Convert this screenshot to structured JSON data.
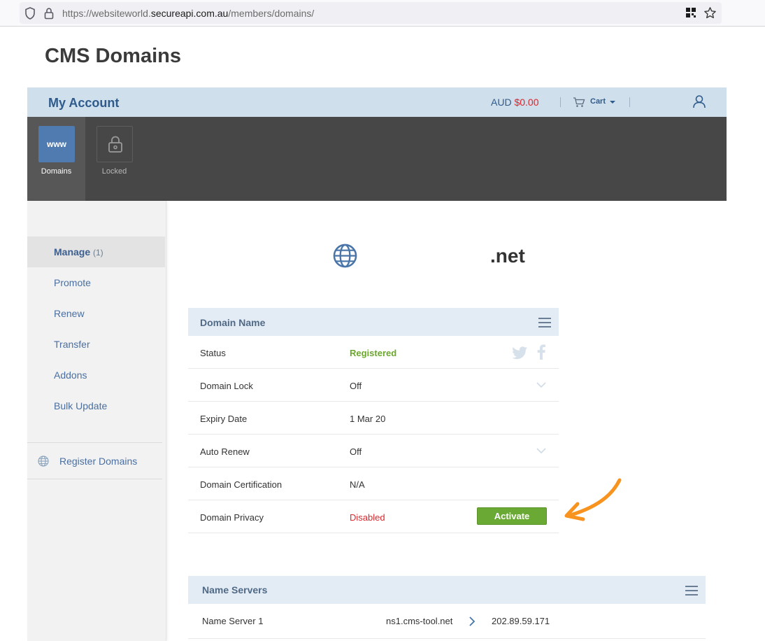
{
  "browser": {
    "url_prefix": "https://websiteworld.",
    "url_domain": "secureapi.com.au",
    "url_path": "/members/domains/"
  },
  "page": {
    "title": "CMS Domains"
  },
  "account_bar": {
    "title": "My Account",
    "currency": "AUD",
    "balance": "$0.00",
    "cart_label": "Cart"
  },
  "tools": [
    {
      "tile_text": "www",
      "label": "Domains",
      "active": true
    },
    {
      "label": "Locked",
      "active": false
    }
  ],
  "sidebar": {
    "items": [
      {
        "label": "Manage",
        "count": "(1)",
        "active": true
      },
      {
        "label": "Promote"
      },
      {
        "label": "Renew"
      },
      {
        "label": "Transfer"
      },
      {
        "label": "Addons"
      },
      {
        "label": "Bulk Update"
      }
    ],
    "register_label": "Register Domains"
  },
  "domain": {
    "tld": ".net"
  },
  "domain_panel": {
    "title": "Domain Name",
    "rows": [
      {
        "key": "Status",
        "value": "Registered"
      },
      {
        "key": "Domain Lock",
        "value": "Off"
      },
      {
        "key": "Expiry Date",
        "value": "1 Mar 20"
      },
      {
        "key": "Auto Renew",
        "value": "Off"
      },
      {
        "key": "Domain Certification",
        "value": "N/A"
      },
      {
        "key": "Domain Privacy",
        "value": "Disabled"
      }
    ],
    "activate_label": "Activate"
  },
  "name_servers": {
    "title": "Name Servers",
    "rows": [
      {
        "key": "Name Server 1",
        "host": "ns1.cms-tool.net",
        "ip": "202.89.59.171"
      }
    ]
  },
  "colors": {
    "accent_blue": "#2f5b8c",
    "status_green": "#6aa72c",
    "alert_red": "#d9262d",
    "arrow_orange": "#f7931e"
  }
}
